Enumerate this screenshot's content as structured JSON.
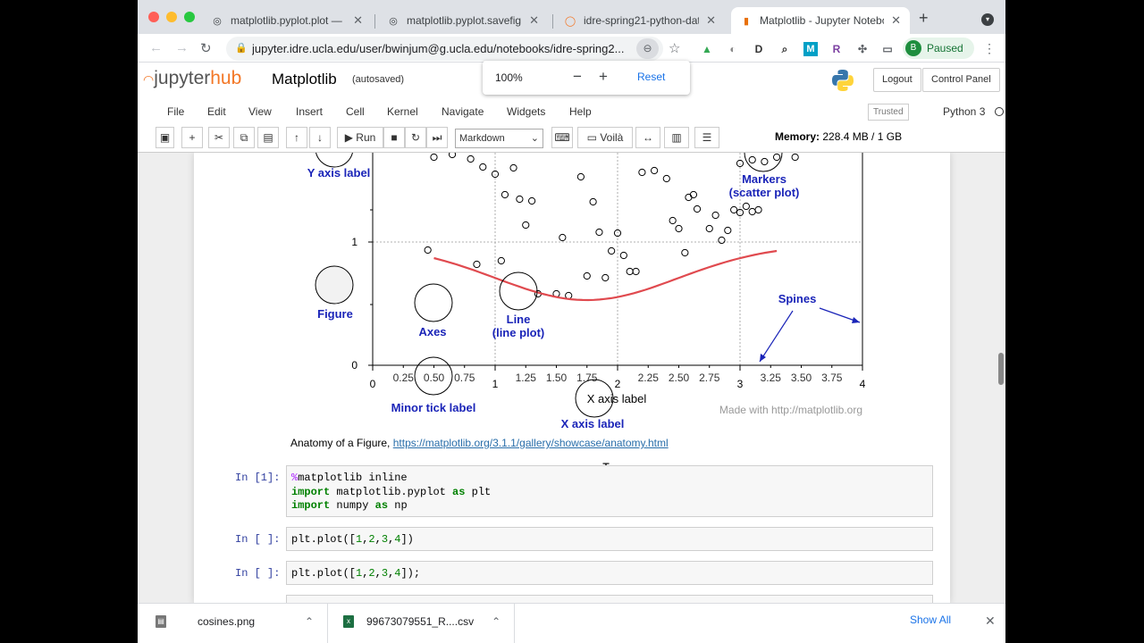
{
  "tabs": [
    {
      "title": "matplotlib.pyplot.plot — Ma",
      "icon": "matplotlib-icon"
    },
    {
      "title": "matplotlib.pyplot.savefig —",
      "icon": "matplotlib-icon"
    },
    {
      "title": "idre-spring21-python-data",
      "icon": "jupyter-icon"
    },
    {
      "title": "Matplotlib - Jupyter Notebo",
      "icon": "notebook-icon"
    }
  ],
  "browser": {
    "url": "jupyter.idre.ucla.edu/user/bwinjum@g.ucla.edu/notebooks/idre-spring2...",
    "profile_initial": "B",
    "profile_status": "Paused",
    "extensions": [
      "M",
      "R"
    ]
  },
  "zoom_popup": {
    "level": "100%",
    "minus": "−",
    "plus": "+",
    "reset": "Reset"
  },
  "jupyter": {
    "logo_prefix": "jupyter",
    "logo_suffix": "hub",
    "notebook_name": "Matplotlib",
    "autosave": "(autosaved)",
    "logout": "Logout",
    "control_panel": "Control Panel",
    "menu": [
      "File",
      "Edit",
      "View",
      "Insert",
      "Cell",
      "Kernel",
      "Navigate",
      "Widgets",
      "Help"
    ],
    "trusted": "Trusted",
    "kernel": "Python 3",
    "run": "Run",
    "voila": "Voilà",
    "cell_type": "Markdown",
    "memory_label": "Memory:",
    "memory_value": "228.4 MB / 1 GB"
  },
  "figure": {
    "labels": {
      "y_axis_label": "Y axis label",
      "markers": "Markers",
      "markers_sub": "(scatter plot)",
      "figure": "Figure",
      "axes": "Axes",
      "line": "Line",
      "line_sub": "(line plot)",
      "spines": "Spines",
      "minor_tick_label": "Minor tick label",
      "x_axis_label_blue": "X axis label",
      "x_axis_label_black": "X axis label",
      "made_with": "Made with http://matplotlib.org"
    },
    "y_ticks": [
      "1",
      "0"
    ],
    "x_major_ticks": [
      "0",
      "1",
      "2",
      "3",
      "4"
    ],
    "x_minor_ticks": [
      "0.25",
      "0.50",
      "0.75",
      "1.25",
      "1.50",
      "1.75",
      "2.25",
      "2.50",
      "2.75",
      "3.25",
      "3.50",
      "3.75"
    ],
    "colors": {
      "annotation": "#1a24b8",
      "line": "#e04a4f"
    }
  },
  "caption": {
    "text": "Anatomy of a Figure, ",
    "link": "https://matplotlib.org/3.1.1/gallery/showcase/anatomy.html"
  },
  "cells": [
    {
      "prompt": "In [1]:",
      "lines": [
        "%matplotlib inline",
        "import matplotlib.pyplot as plt",
        "import numpy as np"
      ]
    },
    {
      "prompt": "In [ ]:",
      "lines": [
        "plt.plot([1,2,3,4])"
      ]
    },
    {
      "prompt": "In [ ]:",
      "lines": [
        "plt.plot([1,2,3,4]);"
      ]
    }
  ],
  "downloads": [
    {
      "name": "cosines.png"
    },
    {
      "name": "99673079551_R....csv"
    }
  ],
  "show_all": "Show All"
}
